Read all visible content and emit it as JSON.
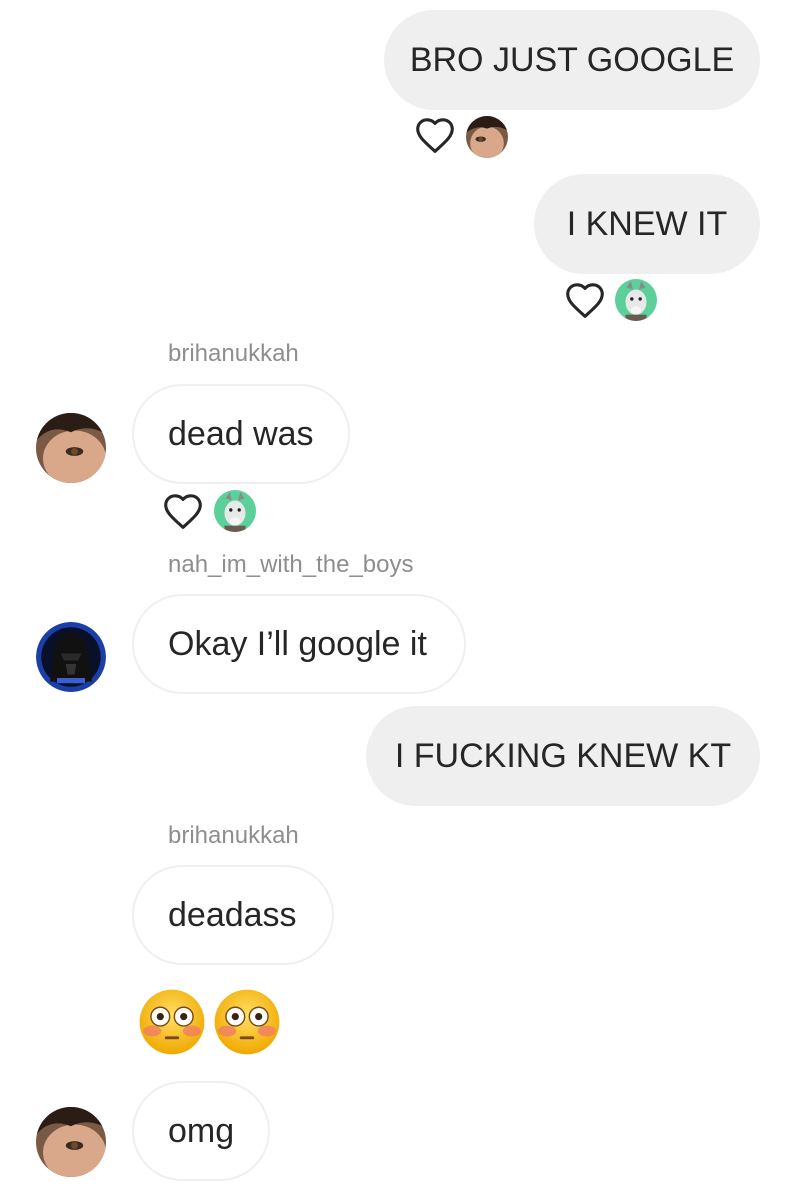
{
  "messages": [
    {
      "sender": "me",
      "text": "BRO JUST GOOGLE",
      "reaction": "heart-icon"
    },
    {
      "sender": "me",
      "text": "I KNEW IT",
      "reaction": "heart-icon"
    },
    {
      "sender": "brihanukkah",
      "username": "brihanukkah",
      "text": "dead was",
      "reaction": "heart-icon"
    },
    {
      "sender": "nah_im_with_the_boys",
      "username": "nah_im_with_the_boys",
      "text": "Okay I’ll google it"
    },
    {
      "sender": "me",
      "text": "I FUCKING KNEW KT"
    },
    {
      "sender": "brihanukkah",
      "username": "brihanukkah",
      "text": "deadass"
    },
    {
      "sender": "brihanukkah",
      "emojis": [
        "flushed-face-emoji",
        "flushed-face-emoji"
      ]
    },
    {
      "sender": "brihanukkah",
      "text": "omg"
    }
  ],
  "colors": {
    "sent_bubble": "#efefef",
    "received_border": "#efefef",
    "username": "#8e8e8e",
    "text": "#262626"
  }
}
